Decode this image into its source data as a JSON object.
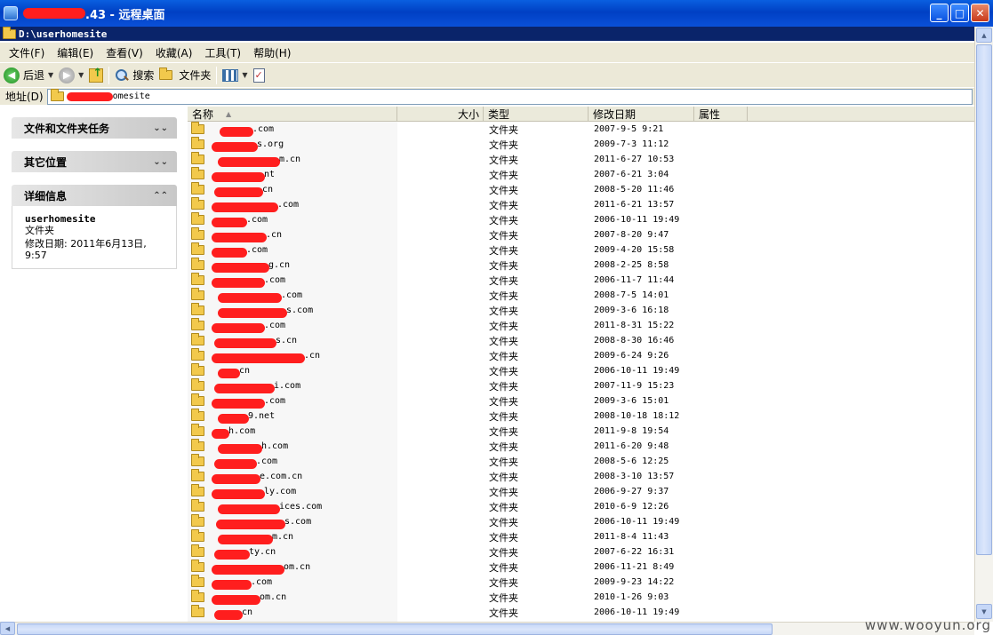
{
  "window": {
    "title_suffix": ".43 - 远程桌面",
    "min": "_",
    "max": "□",
    "close": "✕"
  },
  "explorer": {
    "title": "D:\\userhomesite"
  },
  "menu": [
    "文件(F)",
    "编辑(E)",
    "查看(V)",
    "收藏(A)",
    "工具(T)",
    "帮助(H)"
  ],
  "toolbar": {
    "back": "后退",
    "search": "搜索",
    "folders": "文件夹"
  },
  "address": {
    "label": "地址(D)",
    "value_visible": "omesite"
  },
  "taskpane": {
    "panels": [
      {
        "title": "文件和文件夹任务",
        "state": "collapsed"
      },
      {
        "title": "其它位置",
        "state": "collapsed"
      },
      {
        "title": "详细信息",
        "state": "expanded"
      }
    ],
    "details": {
      "name": "userhomesite",
      "type": "文件夹",
      "modified": "修改日期: 2011年6月13日, 9:57"
    }
  },
  "columns": {
    "name": "名称",
    "size": "大小",
    "type": "类型",
    "date": "修改日期",
    "attr": "属性"
  },
  "files": [
    {
      "name_visible": ".com",
      "type": "文件夹",
      "date": "2007-9-5 9:21"
    },
    {
      "name_visible": "s.org",
      "type": "文件夹",
      "date": "2009-7-3 11:12"
    },
    {
      "name_visible": "m.cn",
      "type": "文件夹",
      "date": "2011-6-27 10:53"
    },
    {
      "name_visible": "nt",
      "type": "文件夹",
      "date": "2007-6-21 3:04"
    },
    {
      "name_visible": "cn",
      "type": "文件夹",
      "date": "2008-5-20 11:46"
    },
    {
      "name_visible": ".com",
      "type": "文件夹",
      "date": "2011-6-21 13:57"
    },
    {
      "name_visible": ".com",
      "type": "文件夹",
      "date": "2006-10-11 19:49"
    },
    {
      "name_visible": ".cn",
      "type": "文件夹",
      "date": "2007-8-20 9:47"
    },
    {
      "name_visible": ".com",
      "type": "文件夹",
      "date": "2009-4-20 15:58"
    },
    {
      "name_visible": "g.cn",
      "type": "文件夹",
      "date": "2008-2-25 8:58"
    },
    {
      "name_visible": ".com",
      "type": "文件夹",
      "date": "2006-11-7 11:44"
    },
    {
      "name_visible": ".com",
      "type": "文件夹",
      "date": "2008-7-5 14:01"
    },
    {
      "name_visible": "s.com",
      "type": "文件夹",
      "date": "2009-3-6 16:18"
    },
    {
      "name_visible": ".com",
      "type": "文件夹",
      "date": "2011-8-31 15:22"
    },
    {
      "name_visible": "s.cn",
      "type": "文件夹",
      "date": "2008-8-30 16:46"
    },
    {
      "name_visible": ".cn",
      "type": "文件夹",
      "date": "2009-6-24 9:26"
    },
    {
      "name_visible": "cn",
      "type": "文件夹",
      "date": "2006-10-11 19:49"
    },
    {
      "name_visible": "i.com",
      "type": "文件夹",
      "date": "2007-11-9 15:23"
    },
    {
      "name_visible": ".com",
      "type": "文件夹",
      "date": "2009-3-6 15:01"
    },
    {
      "name_visible": "9.net",
      "type": "文件夹",
      "date": "2008-10-18 18:12"
    },
    {
      "name_visible": "h.com",
      "type": "文件夹",
      "date": "2011-9-8 19:54"
    },
    {
      "name_visible": "h.com",
      "type": "文件夹",
      "date": "2011-6-20 9:48"
    },
    {
      "name_visible": ".com",
      "type": "文件夹",
      "date": "2008-5-6 12:25"
    },
    {
      "name_visible": "e.com.cn",
      "type": "文件夹",
      "date": "2008-3-10 13:57"
    },
    {
      "name_visible": "ly.com",
      "type": "文件夹",
      "date": "2006-9-27 9:37"
    },
    {
      "name_visible": "ices.com",
      "type": "文件夹",
      "date": "2010-6-9 12:26"
    },
    {
      "name_visible": "s.com",
      "type": "文件夹",
      "date": "2006-10-11 19:49"
    },
    {
      "name_visible": "m.cn",
      "type": "文件夹",
      "date": "2011-8-4 11:43"
    },
    {
      "name_visible": "ty.cn",
      "type": "文件夹",
      "date": "2007-6-22 16:31"
    },
    {
      "name_visible": "om.cn",
      "type": "文件夹",
      "date": "2006-11-21 8:49"
    },
    {
      "name_visible": ".com",
      "type": "文件夹",
      "date": "2009-9-23 14:22"
    },
    {
      "name_visible": "om.cn",
      "type": "文件夹",
      "date": "2010-1-26 9:03"
    },
    {
      "name_visible": "cn",
      "type": "文件夹",
      "date": "2006-10-11 19:49"
    }
  ],
  "watermark": "www.wooyun.org"
}
